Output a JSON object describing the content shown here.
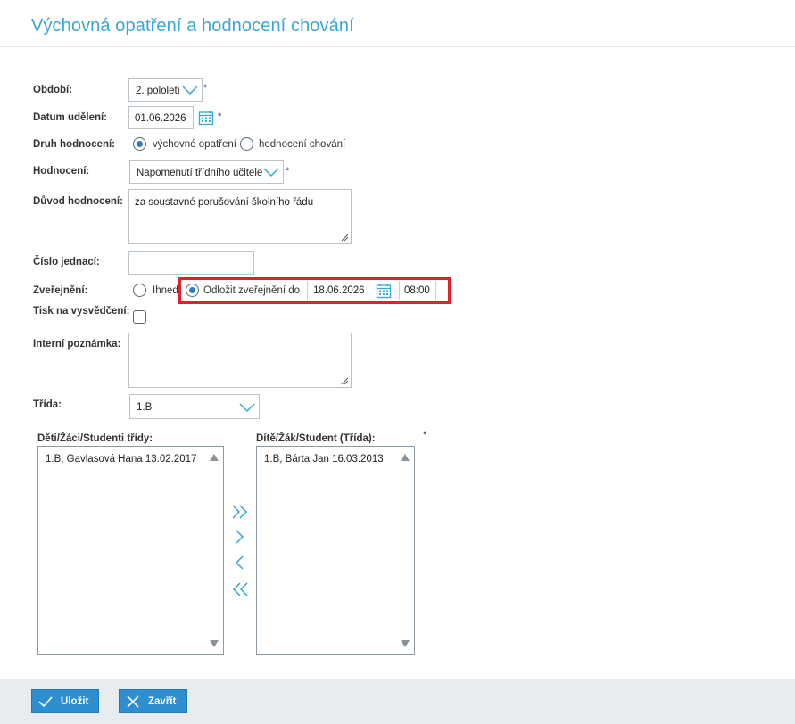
{
  "page": {
    "title": "Výchovná opatření a hodnocení chování"
  },
  "form": {
    "period": {
      "label": "Období:",
      "value": "2. pololetí",
      "required": "*"
    },
    "date": {
      "label": "Datum udělení:",
      "value": "01.06.2026",
      "required": "*"
    },
    "kind": {
      "label": "Druh hodnocení:",
      "option1": "výchovné opatření",
      "option2": "hodnocení chování",
      "selected": "option1"
    },
    "rating": {
      "label": "Hodnocení:",
      "value": "Napomenutí třídního učitele",
      "required": "*"
    },
    "reason": {
      "label": "Důvod hodnocení:",
      "value": "za soustavné porušování školního řádu"
    },
    "reference": {
      "label": "Číslo jednací:",
      "value": ""
    },
    "publish": {
      "label": "Zveřejnění:",
      "option_now": "Ihned",
      "option_delay": "Odložit zveřejnění do",
      "date": "18.06.2026",
      "time": "08:00",
      "selected": "option_delay"
    },
    "print": {
      "label": "Tisk na vysvědčení:"
    },
    "note": {
      "label": "Interní poznámka:",
      "value": ""
    },
    "class": {
      "label": "Třída:",
      "value": "1.B"
    },
    "available": {
      "label": "Děti/Žáci/Studenti třídy:",
      "items": [
        "1.B, Gavlasová Hana 13.02.2017"
      ]
    },
    "selected_list": {
      "label": "Dítě/Žák/Student (Třída):",
      "required": "*",
      "items": [
        "1.B, Bárta Jan 16.03.2013"
      ]
    }
  },
  "footer": {
    "save_label": "Uložit",
    "close_label": "Zavřít"
  },
  "colors": {
    "accent": "#3aa6d8",
    "button": "#2d8ed0",
    "highlight": "#e0202a"
  }
}
